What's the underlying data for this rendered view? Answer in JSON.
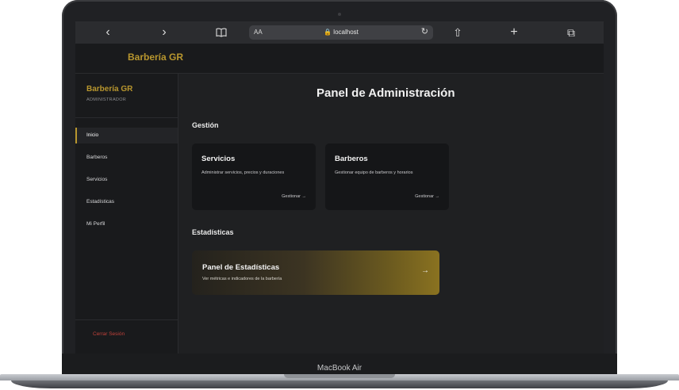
{
  "device": {
    "model_label": "MacBook Air"
  },
  "browser": {
    "back_icon": "‹",
    "forward_icon": "›",
    "bookmarks_icon": "book-icon",
    "aa_label": "AA",
    "url": "🔒 localhost",
    "reload_icon": "↻",
    "share_icon": "⇧",
    "new_tab_icon": "+",
    "tabs_icon": "⧉"
  },
  "topbar": {
    "brand": "Barbería GR"
  },
  "sidebar": {
    "brand": "Barbería GR",
    "role": "ADMINISTRADOR",
    "items": [
      {
        "label": "Inicio",
        "active": true
      },
      {
        "label": "Barberos"
      },
      {
        "label": "Servicios"
      },
      {
        "label": "Estadísticas"
      },
      {
        "label": "Mi Perfil"
      }
    ],
    "logout": "Cerrar Sesión"
  },
  "main": {
    "title": "Panel de Administración",
    "sections": {
      "gestion": "Gestión",
      "estadisticas": "Estadísticas"
    },
    "cards": [
      {
        "title": "Servicios",
        "description": "Administrar servicios, precios y duraciones",
        "link": "Gestionar →"
      },
      {
        "title": "Barberos",
        "description": "Gestionar equipo de barberos y horarios",
        "link": "Gestionar →"
      }
    ],
    "stats_card": {
      "title": "Panel de Estadísticas",
      "description": "Ver métricas e indicadores de la barbería",
      "arrow": "→"
    }
  },
  "colors": {
    "accent_gold": "#b8962e",
    "logout_red": "#c0413a",
    "background": "#1f2022"
  }
}
